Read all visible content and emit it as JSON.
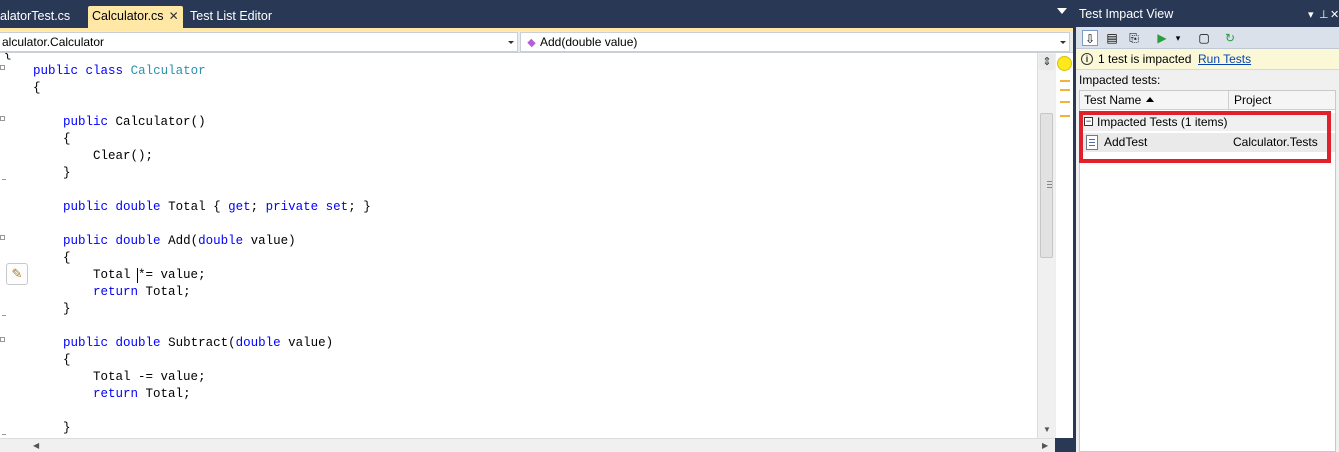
{
  "editor": {
    "tabs": [
      {
        "label": "alatorTest.cs",
        "active": false
      },
      {
        "label": "Calculator.cs",
        "active": true
      },
      {
        "label": "Test List Editor",
        "active": false
      }
    ],
    "tab_close_glyph": "✕",
    "nav": {
      "type_combo": "alculator.Calculator",
      "member_combo": "Add(double value)",
      "member_icon": "method-icon"
    },
    "code_lines": [
      [
        "",
        "{"
      ],
      [
        "    ",
        "public class Calculator"
      ],
      [
        "    ",
        "{"
      ],
      [
        "",
        ""
      ],
      [
        "        ",
        "public Calculator()"
      ],
      [
        "        ",
        "{"
      ],
      [
        "            ",
        "Clear();"
      ],
      [
        "        ",
        "}"
      ],
      [
        "",
        ""
      ],
      [
        "        ",
        "public double Total { get; private set; }"
      ],
      [
        "",
        ""
      ],
      [
        "        ",
        "public double Add(double value)"
      ],
      [
        "        ",
        "{"
      ],
      [
        "            ",
        "Total *= value;"
      ],
      [
        "            ",
        "return Total;"
      ],
      [
        "        ",
        "}"
      ],
      [
        "",
        ""
      ],
      [
        "        ",
        "public double Subtract(double value)"
      ],
      [
        "        ",
        "{"
      ],
      [
        "            ",
        "Total -= value;"
      ],
      [
        "            ",
        "return Total;"
      ],
      [
        "",
        ""
      ],
      [
        "        ",
        "}"
      ]
    ],
    "smart_tag_icon": "pencil-icon",
    "colors": {
      "keyword": "#0000ff",
      "type": "#2b91af",
      "active_tab": "#ffe8a6",
      "chrome": "#293955"
    }
  },
  "test_impact": {
    "title": "Test Impact View",
    "title_icons": [
      "dropdown-arrow-icon",
      "pin-icon",
      "close-icon"
    ],
    "toolbar_icons": [
      "show-impacted-tests-icon",
      "show-calling-tests-icon",
      "show-code-changes-icon",
      "run-tests-icon",
      "dropdown-arrow-icon",
      "copy-icon",
      "refresh-icon"
    ],
    "info_text": "1 test is impacted",
    "run_tests_link": "Run Tests",
    "impacted_label": "Impacted tests:",
    "columns": [
      "Test Name",
      "Project"
    ],
    "group": {
      "toggle": "−",
      "label": "Impacted Tests (1 items)"
    },
    "rows": [
      {
        "name": "AddTest",
        "project": "Calculator.Tests"
      }
    ],
    "highlight_color": "#e0202b"
  }
}
